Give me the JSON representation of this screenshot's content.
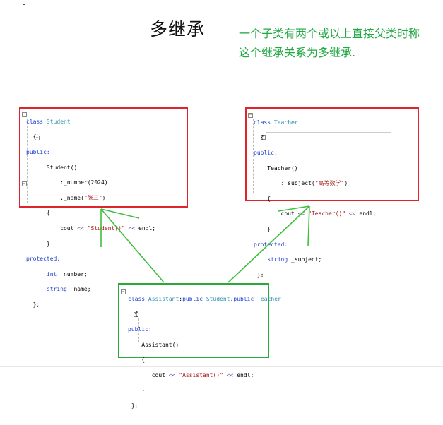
{
  "title": "多继承",
  "description": {
    "line1": "一个子类有两个或以上直接父类时称",
    "line2": "这个继承关系为多继承."
  },
  "colors": {
    "red_box": "#e0242b",
    "green_box": "#2aa83a",
    "description_text": "#22a844",
    "keyword": "#1f3fcf",
    "type_name": "#2b91af",
    "string_literal": "#a31515"
  },
  "student_code": {
    "l1_kw": "class",
    "l1_name": "Student",
    "l2": "{",
    "l3": "public:",
    "l4": "Student()",
    "l5": ":_number(2024)",
    "l6_pre": ",_name(",
    "l6_str": "\"张三\"",
    "l6_post": ")",
    "l7": "{",
    "l8_pre": "cout ",
    "l8_op": "<<",
    "l8_str": "\"Student()\"",
    "l8_op2": "<<",
    "l8_post": "endl;",
    "l9": "}",
    "l10": "protected:",
    "l11_type": "int",
    "l11_name": "_number;",
    "l12_type": "string",
    "l12_name": "_name;",
    "l13": "};"
  },
  "teacher_code": {
    "l1_kw": "class",
    "l1_name": "Teacher",
    "l2": "{",
    "l3": "public:",
    "l4": "Teacher()",
    "l5_pre": ":_subject(",
    "l5_str": "\"高等数学\"",
    "l5_post": ")",
    "l6": "{",
    "l7_pre": "cout ",
    "l7_op": "<<",
    "l7_str": "\"Teacher()\"",
    "l7_op2": "<<",
    "l7_post": "endl;",
    "l8": "}",
    "l9": "protected:",
    "l10_type": "string",
    "l10_name": "_subject;",
    "l11": "};"
  },
  "assistant_code": {
    "l1_kw": "class",
    "l1_name": "Assistant",
    "l1_colon": ":",
    "l1_pub1": "public",
    "l1_base1": "Student",
    "l1_comma": ",",
    "l1_pub2": "public",
    "l1_base2": "Teacher",
    "l2": "{",
    "l3": "public:",
    "l4": "Assistant()",
    "l5": "{",
    "l6_pre": "cout ",
    "l6_op": "<<",
    "l6_str": "\"Assistant()\"",
    "l6_op2": "<<",
    "l6_post": "endl;",
    "l7": "}",
    "l8": "};"
  },
  "fold_glyph": "−"
}
